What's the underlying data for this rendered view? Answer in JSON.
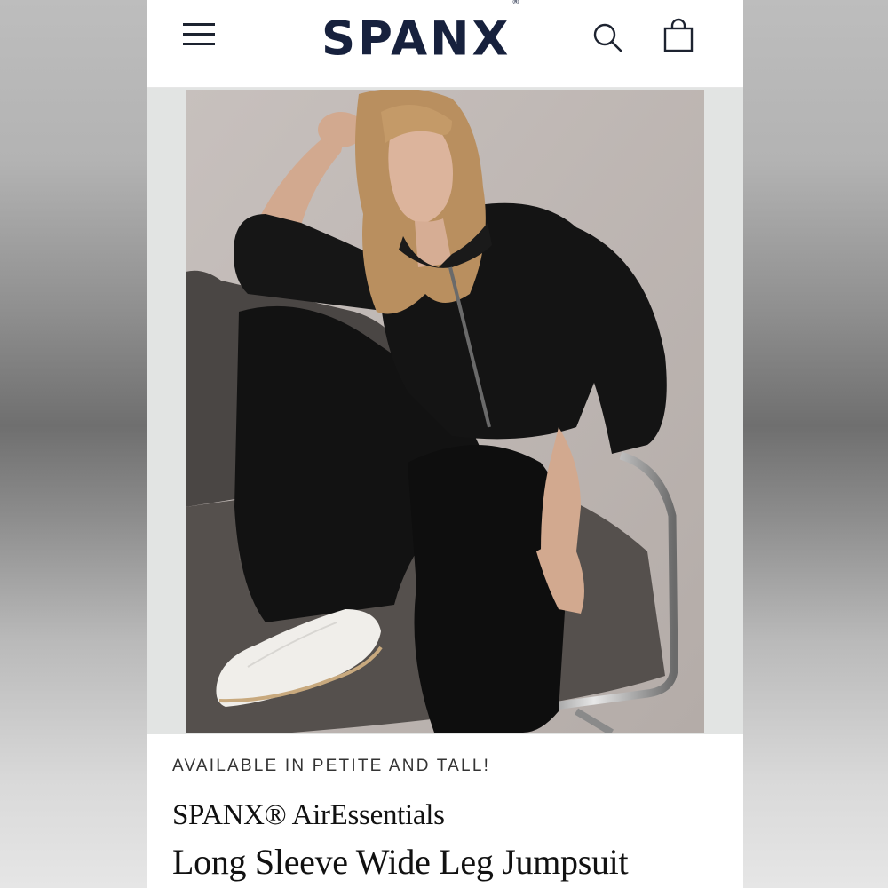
{
  "header": {
    "logo_text": "SPANX",
    "logo_mark": "®",
    "menu_icon": "hamburger-menu-icon",
    "search_icon": "search-icon",
    "bag_icon": "shopping-bag-icon"
  },
  "product": {
    "tagline": "AVAILABLE IN PETITE AND TALL!",
    "brand": "SPANX® AirEssentials",
    "title": "Long Sleeve Wide Leg Jumpsuit"
  },
  "colors": {
    "brand_navy": "#17213d",
    "text": "#111111"
  }
}
